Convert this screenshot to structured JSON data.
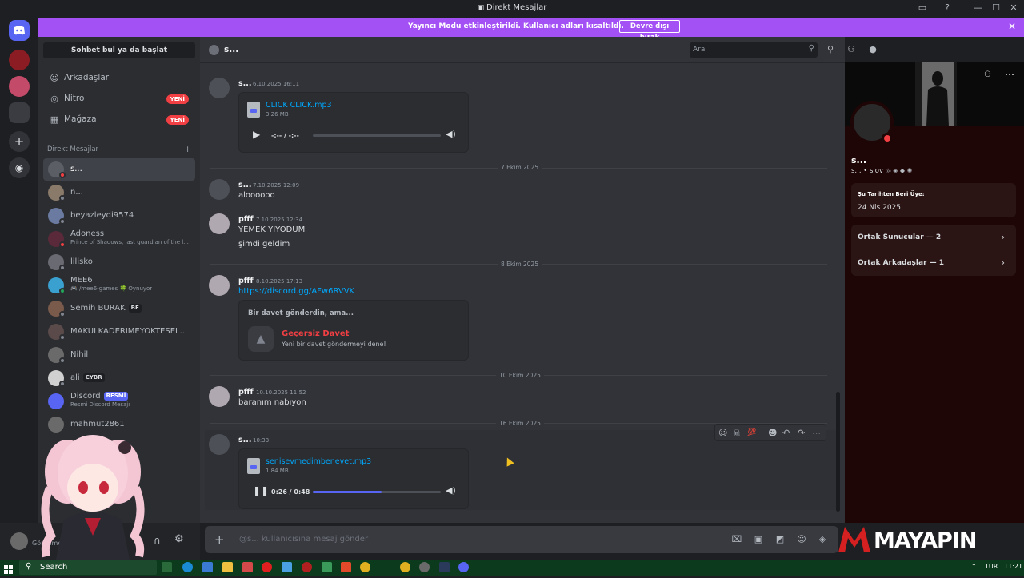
{
  "window": {
    "title": "Direkt Mesajlar"
  },
  "banner": {
    "text": "Yayıncı Modu etkinleştirildi. Kullanıcı adları kısaltıldı.",
    "button": "Devre dışı bırak"
  },
  "sidebar": {
    "search_button": "Sohbet bul ya da başlat",
    "nav": [
      {
        "label": "Arkadaşlar",
        "icon": "friends-icon"
      },
      {
        "label": "Nitro",
        "icon": "nitro-icon",
        "badge": "YENİ"
      },
      {
        "label": "Mağaza",
        "icon": "shop-icon",
        "badge": "YENİ"
      }
    ],
    "dm_header": "Direkt Mesajlar",
    "dms": [
      {
        "name": "s..."
      },
      {
        "name": "n..."
      },
      {
        "name": "beyazleydi9574"
      },
      {
        "name": "Adoness",
        "sub": "Prince of Shadows, last guardian of the l..."
      },
      {
        "name": "lilisko"
      },
      {
        "name": "MEE6",
        "sub": "🎮 /mee6-games 🍀 Oynuyor"
      },
      {
        "name": "Semih BURAK",
        "tag": "BF"
      },
      {
        "name": "MAKULKADERİMEYOKTESEL..."
      },
      {
        "name": "Nihil"
      },
      {
        "name": "ali",
        "tag": "CYBR"
      },
      {
        "name": "Discord",
        "tag": "RESMİ",
        "sub": "Resmi Discord Mesajı"
      },
      {
        "name": "mahmut2861"
      }
    ],
    "user_status": "Görünmez"
  },
  "chat": {
    "header_name": "s...",
    "search_placeholder": "Ara",
    "messages": [
      {
        "author": "s...",
        "time": "6.10.2025 16:11",
        "file": "CLICK CLICK.mp3",
        "size": "3.26 MB",
        "player_time": "-:-- / -:--",
        "progress": 0.0
      },
      {
        "divider": "7 Ekim 2025"
      },
      {
        "author": "s...",
        "time": "7.10.2025 12:09",
        "text": "aloooooo"
      },
      {
        "author": "pfff",
        "time": "7.10.2025 12:34",
        "text": "YEMEK YİYODUM",
        "text2": "şimdi geldim"
      },
      {
        "divider": "8 Ekim 2025"
      },
      {
        "author": "pfff",
        "time": "8.10.2025 17:13",
        "link": "https://discord.gg/AFw6RVVK",
        "invite_header": "Bir davet gönderdin, ama...",
        "invite_title": "Geçersiz Davet",
        "invite_sub": "Yeni bir davet göndermeyi dene!"
      },
      {
        "divider": "10 Ekim 2025"
      },
      {
        "author": "pfff",
        "time": "10.10.2025 11:52",
        "text": "baranım nabıyon"
      },
      {
        "divider": "16 Ekim 2025"
      },
      {
        "author": "s...",
        "time": "10:33",
        "file": "senisevmedimbenevet.mp3",
        "size": "1.84 MB",
        "player_time": "0:26 / 0:48",
        "progress": 0.54
      }
    ],
    "input_placeholder": "@s... kullanıcısına mesaj gönder"
  },
  "profile": {
    "name": "s...",
    "username": "s...",
    "pronoun": "slov",
    "member_since_label": "Şu Tarihten Beri Üye:",
    "member_since": "24 Nis 2025",
    "mutual_servers": "Ortak Sunucular — 2",
    "mutual_friends": "Ortak Arkadaşlar — 1"
  },
  "taskbar": {
    "search": "Search",
    "lang": "TUR",
    "clock": "11:21"
  },
  "watermark": {
    "text": "MAYAPIN"
  },
  "colors": {
    "accent": "#5865f2",
    "banner": "#a351f5",
    "danger": "#f23f43",
    "link": "#00a8fc"
  }
}
